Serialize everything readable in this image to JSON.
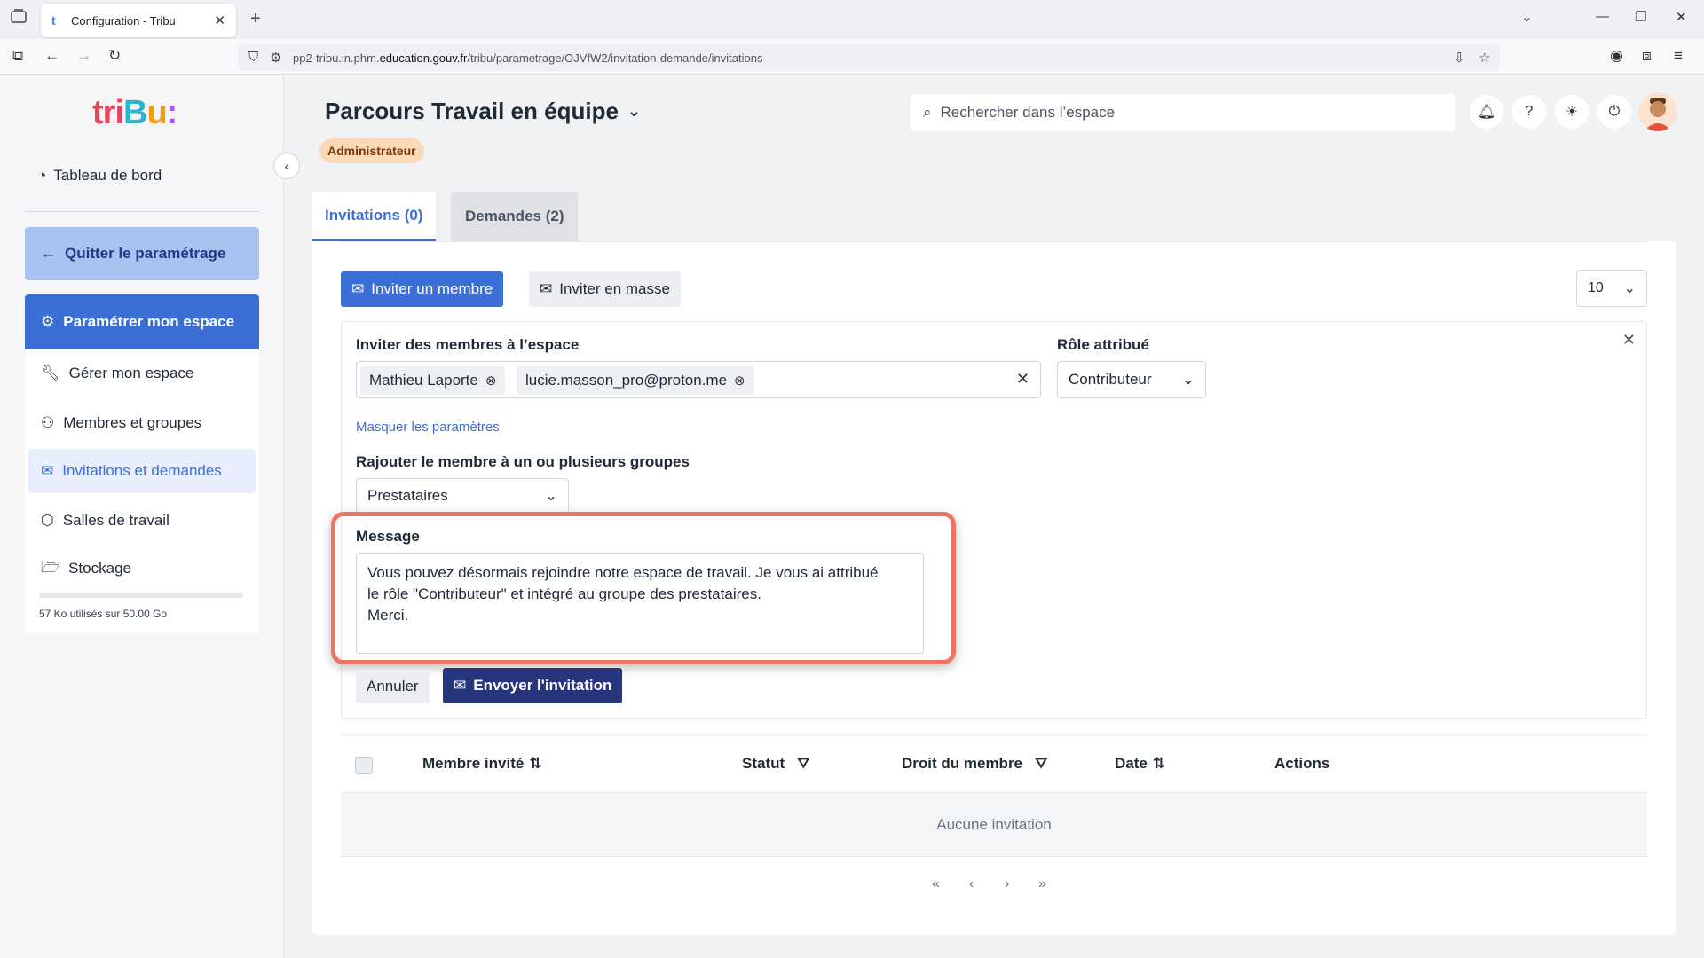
{
  "browser": {
    "tab_title": "Configuration - Tribu",
    "url_prefix": "pp2-tribu.in.phm.",
    "url_domain": "education.gouv.fr",
    "url_path": "/tribu/parametrage/OJVfW2/invitation-demande/invitations"
  },
  "sidebar": {
    "logo": {
      "t1": "tri",
      "t2": "B",
      "t3": "u",
      "t4": ":"
    },
    "dashboard": "Tableau de bord",
    "quit": "Quitter le paramétrage",
    "param": "Paramétrer mon espace",
    "items": [
      {
        "label": "Gérer mon espace",
        "icon": "wrench-icon"
      },
      {
        "label": "Membres et groupes",
        "icon": "users-icon"
      },
      {
        "label": "Invitations et demandes",
        "icon": "mail-icon",
        "active": true
      },
      {
        "label": "Salles de travail",
        "icon": "cube-icon"
      },
      {
        "label": "Stockage",
        "icon": "folder-icon"
      }
    ],
    "storage_text": "57 Ko utilisés sur 50.00 Go",
    "storage_fraction": 0.001
  },
  "header": {
    "title": "Parcours Travail en équipe",
    "role_badge": "Administrateur",
    "search_placeholder": "Rechercher dans l’espace"
  },
  "tabs": [
    {
      "label": "Invitations (0)",
      "active": true
    },
    {
      "label": "Demandes (2)",
      "active": false
    }
  ],
  "toolbar": {
    "invite_one": "Inviter un membre",
    "invite_mass": "Inviter en masse",
    "page_size": "10"
  },
  "form": {
    "invite_label": "Inviter des membres à l’espace",
    "chips": [
      "Mathieu Laporte",
      "lucie.masson_pro@proton.me"
    ],
    "role_label": "Rôle attribué",
    "role_value": "Contributeur",
    "hide_params": "Masquer les paramètres",
    "groups_label": "Rajouter le membre à un ou plusieurs groupes",
    "groups_value": "Prestataires",
    "message_label": "Message",
    "message_lines": [
      "Vous pouvez désormais rejoindre notre espace de travail. Je vous ai attribué",
      "le rôle \"Contributeur\" et intégré au groupe des prestataires.",
      "Merci."
    ],
    "cancel": "Annuler",
    "send": "Envoyer l'invitation"
  },
  "table": {
    "columns": [
      "Membre invité",
      "Statut",
      "Droit du membre",
      "Date",
      "Actions"
    ],
    "empty": "Aucune invitation"
  },
  "pagination": {
    "first": "«",
    "prev": "‹",
    "next": "›",
    "last": "»"
  },
  "colors": {
    "accent": "#3b6fd6",
    "send": "#27357c",
    "highlight": "#ef7468"
  }
}
